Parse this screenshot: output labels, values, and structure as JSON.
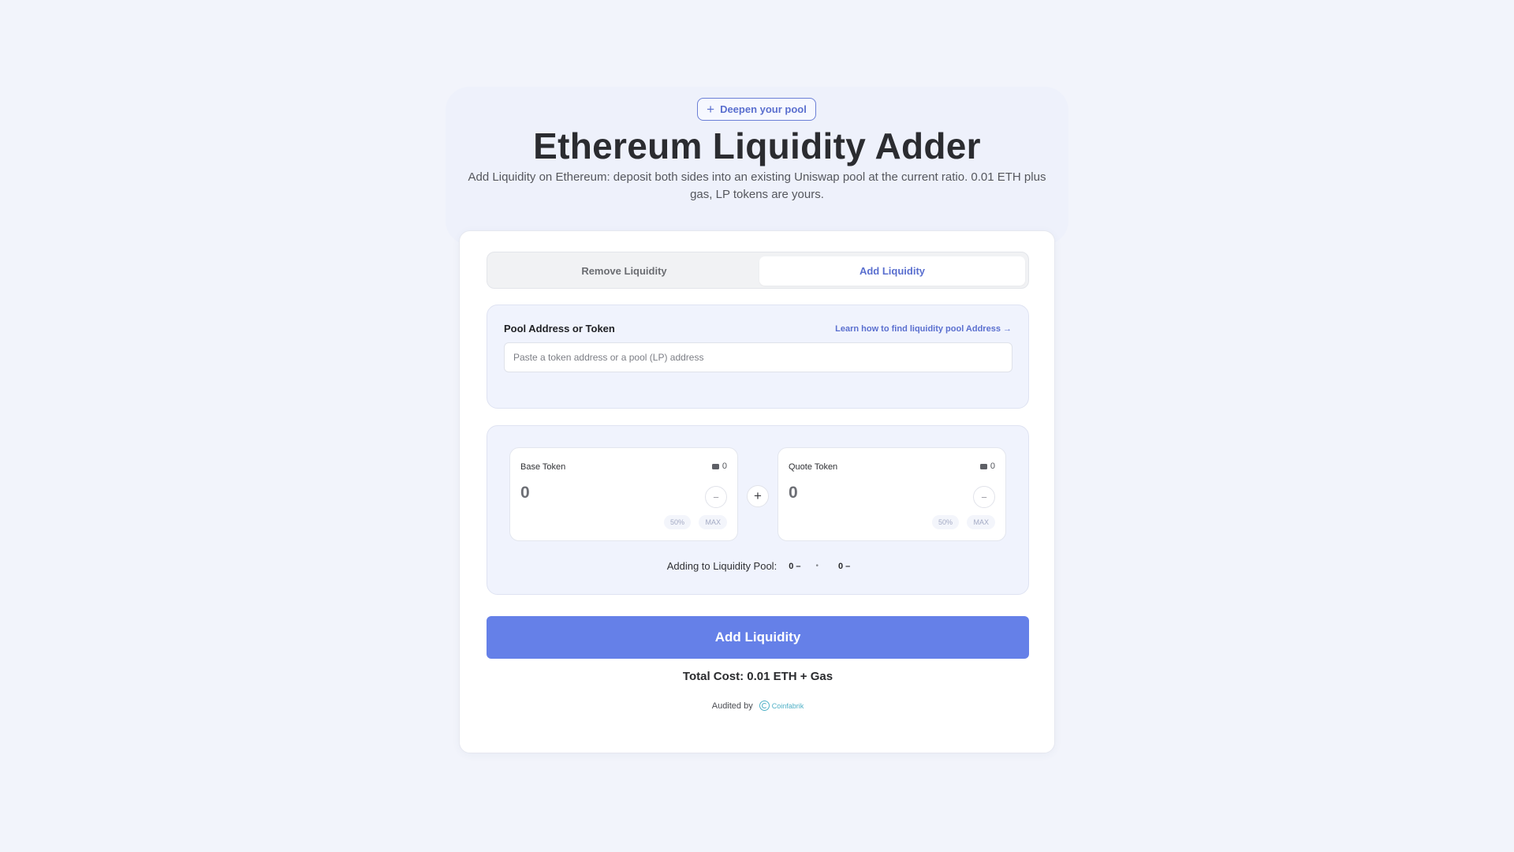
{
  "hero": {
    "badge_label": "Deepen your pool",
    "title": "Ethereum Liquidity Adder",
    "subtitle": "Add Liquidity on Ethereum: deposit both sides into an existing Uniswap pool at the current ratio. 0.01 ETH plus gas, LP tokens are yours."
  },
  "tabs": [
    {
      "label": "Remove Liquidity",
      "active": false
    },
    {
      "label": "Add Liquidity",
      "active": true
    }
  ],
  "pool": {
    "label": "Pool Address or Token",
    "help_link": "Learn how to find liquidity pool Address →",
    "input_placeholder": "Paste a token address or a pool (LP) address",
    "input_value": ""
  },
  "tokens": {
    "base": {
      "name": "Base Token",
      "balance": "0",
      "amount": "0",
      "minus": "−",
      "half_label": "50%",
      "max_label": "MAX"
    },
    "quote": {
      "name": "Quote Token",
      "balance": "0",
      "amount": "0",
      "minus": "−",
      "half_label": "50%",
      "max_label": "MAX"
    },
    "plus": "+"
  },
  "adding": {
    "label": "Adding to Liquidity Pool:",
    "base_value": "0 –",
    "separator": "•",
    "quote_value": "0 –"
  },
  "cta": {
    "label": "Add Liquidity"
  },
  "footer": {
    "total_cost": "Total Cost: 0.01 ETH + Gas",
    "audited_by": "Audited by",
    "auditor": "Coinfabrik"
  },
  "colors": {
    "accent": "#6580e8",
    "link": "#5a6fcf",
    "background": "#f2f4fb"
  }
}
